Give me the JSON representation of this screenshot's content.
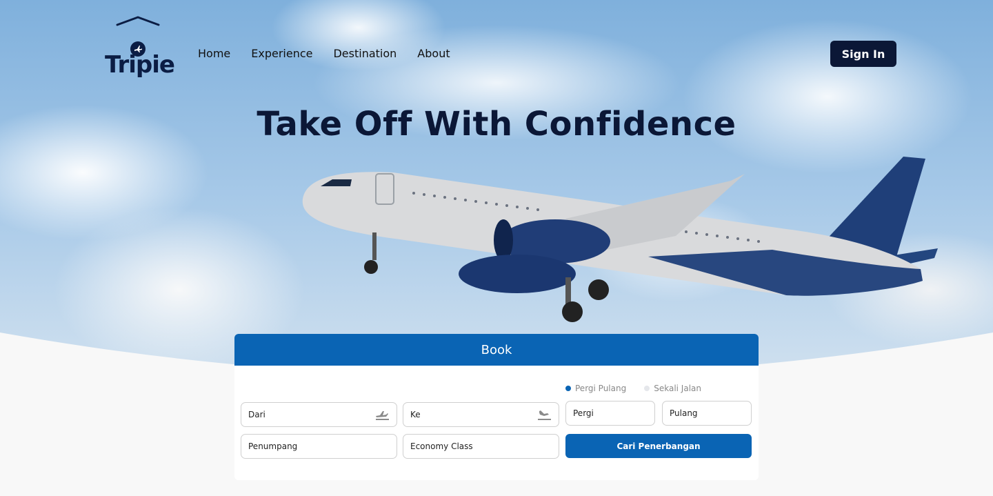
{
  "brand": {
    "name": "Tripie"
  },
  "nav": {
    "items": [
      "Home",
      "Experience",
      "Destination",
      "About"
    ],
    "signin_label": "Sign In"
  },
  "hero": {
    "title": "Take Off With Confidence"
  },
  "book": {
    "header": "Book",
    "trip_type": {
      "options": [
        "Pergi Pulang",
        "Sekali Jalan"
      ],
      "selected": "Pergi Pulang"
    },
    "fields": {
      "from_placeholder": "Dari",
      "to_placeholder": "Ke",
      "depart_placeholder": "Pergi",
      "return_placeholder": "Pulang",
      "passengers_placeholder": "Penumpang",
      "class_value": "Economy Class"
    },
    "search_label": "Cari Penerbangan"
  },
  "colors": {
    "primary": "#0a64b4",
    "navy": "#0b1736",
    "fuselage": "#d9dadc",
    "tail": "#1f3f79"
  },
  "icons": {
    "from": "takeoff-icon",
    "to": "landing-icon",
    "logo": "plane-icon"
  }
}
